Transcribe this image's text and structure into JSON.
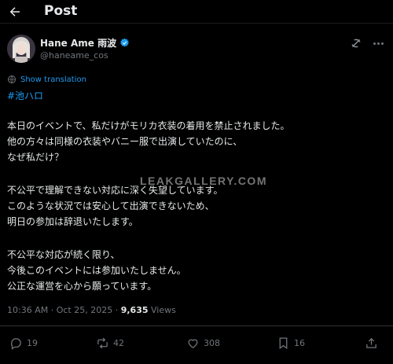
{
  "header": {
    "title": "Post",
    "back_icon": "arrow-left-icon"
  },
  "author": {
    "display_name": "Hane Ame 雨波",
    "handle": "@haneame_cos",
    "verified": true,
    "verified_color": "#1d9bf0"
  },
  "translate": {
    "label": "Show translation"
  },
  "hashtag": "#池ハロ",
  "paragraphs": [
    [
      "本日のイベントで、私だけがモリカ衣装の着用を禁止されました。",
      "他の方々は同様の衣装やバニー服で出演していたのに、",
      "なぜ私だけ？"
    ],
    [
      "不公平で理解できない対応に深く失望しています。",
      "このような状況では安心して出演できないため、",
      "明日の参加は辞退いたします。"
    ],
    [
      "不公平な対応が続く限り、",
      "今後このイベントには参加いたしません。",
      "公正な運営を心から願っています。"
    ]
  ],
  "watermark": "LEAKGALLERY.COM",
  "meta": {
    "time": "10:36 AM",
    "separator": "·",
    "date": "Oct 25, 2025",
    "views_count": "9,635",
    "views_label": "Views"
  },
  "actions": {
    "replies": "19",
    "reposts": "42",
    "likes": "308",
    "bookmarks": "16"
  },
  "colors": {
    "background": "#000000",
    "text": "#e7e9ea",
    "muted": "#71767b",
    "accent": "#1d9bf0"
  }
}
